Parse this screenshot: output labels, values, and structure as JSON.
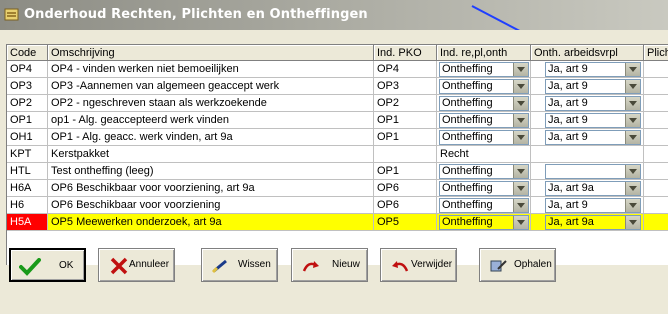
{
  "window": {
    "title": "Onderhoud Rechten, Plichten en Ontheffingen"
  },
  "columns": [
    "Code",
    "Omschrijving",
    "Ind. PKO",
    "Ind. re,pl,onth",
    "Onth. arbeidsvrpl",
    "Plich"
  ],
  "rows": [
    {
      "code": "OP4",
      "desc": "OP4 - vinden werken niet bemoeilijken",
      "pko": "OP4",
      "ind": "Ontheffing",
      "onth": "Ja, art 9"
    },
    {
      "code": "OP3",
      "desc": "OP3 -Aannemen van algemeen geaccept werk",
      "pko": "OP3",
      "ind": "Ontheffing",
      "onth": "Ja, art 9"
    },
    {
      "code": "OP2",
      "desc": "OP2 - ngeschreven staan als werkzoekende",
      "pko": "OP2",
      "ind": "Ontheffing",
      "onth": "Ja, art 9"
    },
    {
      "code": "OP1",
      "desc": "op1 - Alg. geaccepteerd werk vinden",
      "pko": "OP1",
      "ind": "Ontheffing",
      "onth": "Ja, art 9"
    },
    {
      "code": "OH1",
      "desc": "OP1 - Alg. geacc. werk vinden, art 9a",
      "pko": "OP1",
      "ind": "Ontheffing",
      "onth": "Ja, art 9"
    },
    {
      "code": "KPT",
      "desc": "Kerstpakket",
      "pko": "",
      "ind": "Recht",
      "onth": ""
    },
    {
      "code": "HTL",
      "desc": "Test ontheffing (leeg)",
      "pko": "OP1",
      "ind": "Ontheffing",
      "onth": ""
    },
    {
      "code": "H6A",
      "desc": "OP6 Beschikbaar voor voorziening, art 9a",
      "pko": "OP6",
      "ind": "Ontheffing",
      "onth": "Ja, art 9a"
    },
    {
      "code": "H6",
      "desc": "OP6 Beschikbaar voor voorziening",
      "pko": "OP6",
      "ind": "Ontheffing",
      "onth": "Ja, art 9"
    },
    {
      "code": "H5A",
      "desc": "OP5 Meewerken onderzoek, art 9a",
      "pko": "OP5",
      "ind": "Ontheffing",
      "onth": "Ja, art 9a"
    }
  ],
  "buttons": {
    "ok": "OK",
    "annuleer": "Annuleer",
    "wissen": "Wissen",
    "nieuw": "Nieuw",
    "verwijder": "Verwijder",
    "ophalen": "Ophalen"
  },
  "colors": {
    "selected_row": "#ffff00",
    "selected_code": "#ff0000",
    "annotation_arrow": "#1f3fff"
  }
}
